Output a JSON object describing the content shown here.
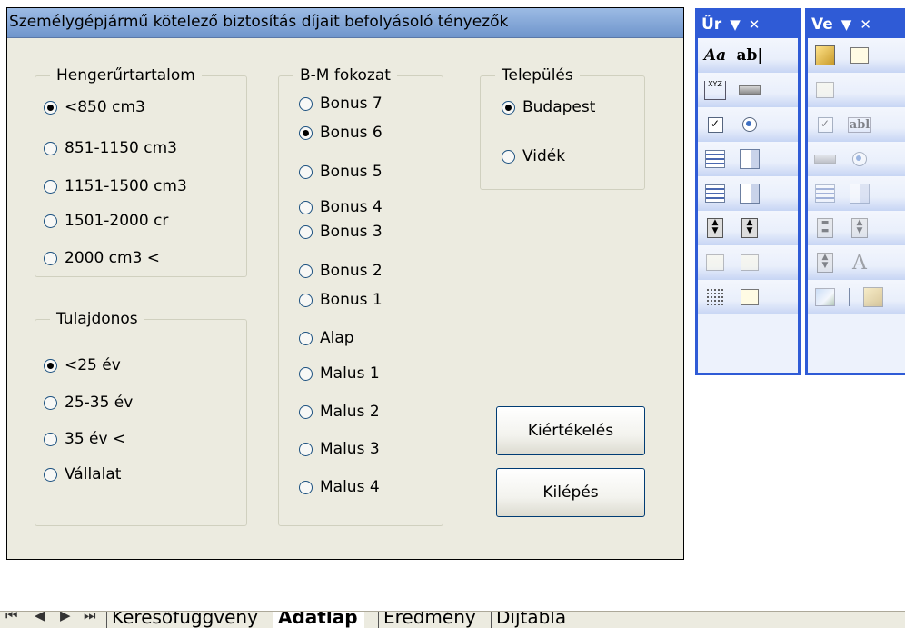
{
  "form": {
    "title": "Személygépjármű kötelező biztosítás díjait befolyásoló tényezők",
    "groups": {
      "engine": {
        "legend": "Hengerűrtartalom",
        "options": [
          "<850 cm3",
          "851-1150 cm3",
          "1151-1500 cm3",
          "1501-2000 cr",
          "2000 cm3 <"
        ],
        "selected": "<850 cm3"
      },
      "owner": {
        "legend": "Tulajdonos",
        "options": [
          "<25 év",
          "25-35 év",
          "35 év <",
          "Vállalat"
        ],
        "selected": "<25 év"
      },
      "bm": {
        "legend": "B-M fokozat",
        "options": [
          "Bonus 7",
          "Bonus 6",
          "Bonus 5",
          "Bonus 4",
          "Bonus 3",
          "Bonus 2",
          "Bonus 1",
          "Alap",
          "Malus 1",
          "Malus 2",
          "Malus 3",
          "Malus 4"
        ],
        "selected": "Bonus 6"
      },
      "location": {
        "legend": "Település",
        "options": [
          "Budapest",
          "Vidék"
        ],
        "selected": "Budapest"
      }
    },
    "buttons": {
      "evaluate": "Kiértékelés",
      "exit": "Kilépés"
    }
  },
  "toolbars": {
    "forms": {
      "title": "Űr",
      "dropdown": "▼",
      "close": "✕",
      "ab_label": "ab|",
      "aa_label": "Aa",
      "frame_label": "XYZ"
    },
    "controls": {
      "title": "Ve",
      "dropdown": "▼",
      "close": "✕",
      "ab_label": "abl",
      "A_label": "A"
    }
  },
  "sheet_tabs": {
    "nav": [
      "⏮",
      "◀",
      "▶",
      "⏭"
    ],
    "tabs": [
      "Keresőfüggvény",
      "Adatlap",
      "Eredmény",
      "Díjtábla"
    ],
    "active": "Adatlap"
  }
}
